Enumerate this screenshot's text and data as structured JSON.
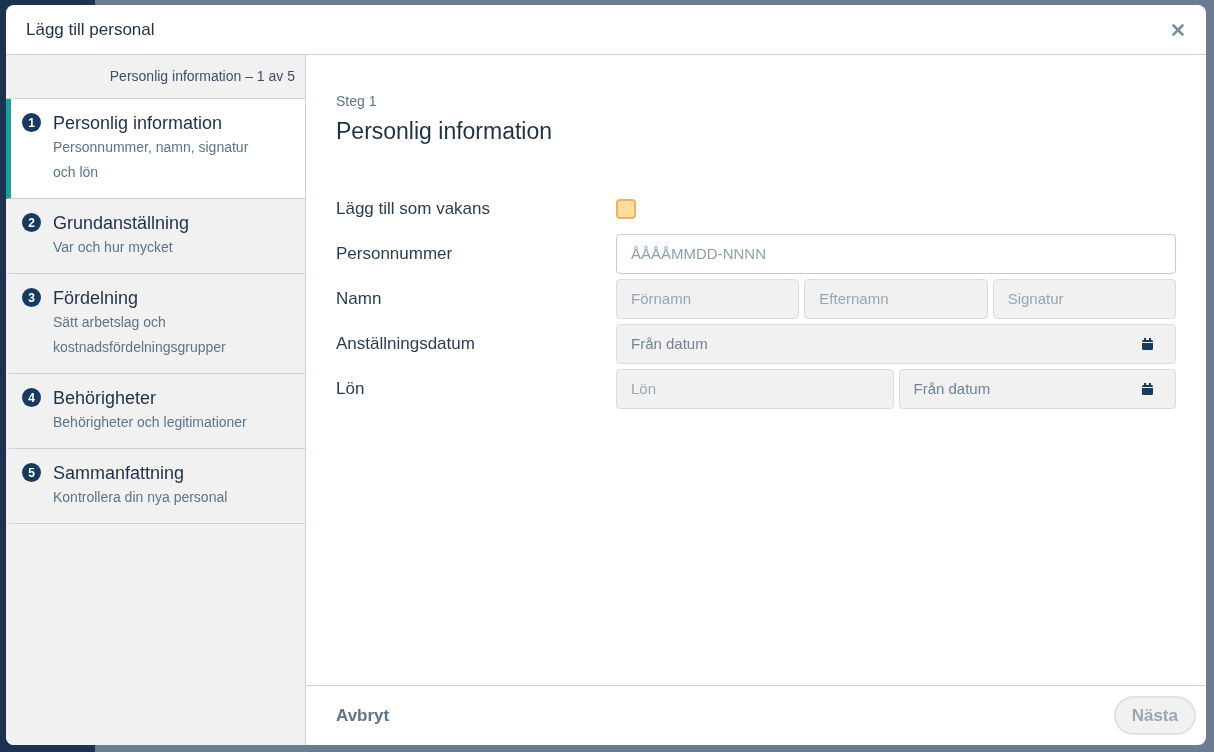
{
  "dialog": {
    "title": "Lägg till personal"
  },
  "sidebar": {
    "progress": "Personlig information – 1 av 5",
    "steps": [
      {
        "number": "1",
        "title": "Personlig information",
        "subtitle": "Personnummer, namn, signatur och lön",
        "selected": true
      },
      {
        "number": "2",
        "title": "Grundanställning",
        "subtitle": "Var och hur mycket",
        "selected": false
      },
      {
        "number": "3",
        "title": "Fördelning",
        "subtitle": "Sätt arbetslag och kostnadsfördelningsgrupper",
        "selected": false
      },
      {
        "number": "4",
        "title": "Behörigheter",
        "subtitle": "Behörigheter och legitimationer",
        "selected": false
      },
      {
        "number": "5",
        "title": "Sammanfattning",
        "subtitle": "Kontrollera din nya personal",
        "selected": false
      }
    ]
  },
  "main": {
    "step_label": "Steg 1",
    "heading": "Personlig information",
    "fields": [
      {
        "kind": "checkbox",
        "label": "Lägg till som vakans",
        "checked": false
      },
      {
        "kind": "inputs",
        "label": "Personnummer",
        "inputs": [
          {
            "kind": "text",
            "placeholder": "ÅÅÅÅMMDD-NNNN",
            "disabled": false
          }
        ]
      },
      {
        "kind": "inputs",
        "label": "Namn",
        "inputs": [
          {
            "kind": "text",
            "placeholder": "Förnamn",
            "disabled": true
          },
          {
            "kind": "text",
            "placeholder": "Efternamn",
            "disabled": true
          },
          {
            "kind": "text",
            "placeholder": "Signatur",
            "disabled": true
          }
        ]
      },
      {
        "kind": "inputs",
        "label": "Anställningsdatum",
        "inputs": [
          {
            "kind": "date",
            "value": "Från datum",
            "disabled": true
          }
        ]
      },
      {
        "kind": "inputs",
        "label": "Lön",
        "inputs": [
          {
            "kind": "text",
            "placeholder": "Lön",
            "disabled": true
          },
          {
            "kind": "date",
            "value": "Från datum",
            "disabled": true
          }
        ]
      }
    ]
  },
  "footer": {
    "cancel": {
      "label": "Avbryt"
    },
    "next": {
      "label": "Nästa",
      "disabled": true
    }
  }
}
